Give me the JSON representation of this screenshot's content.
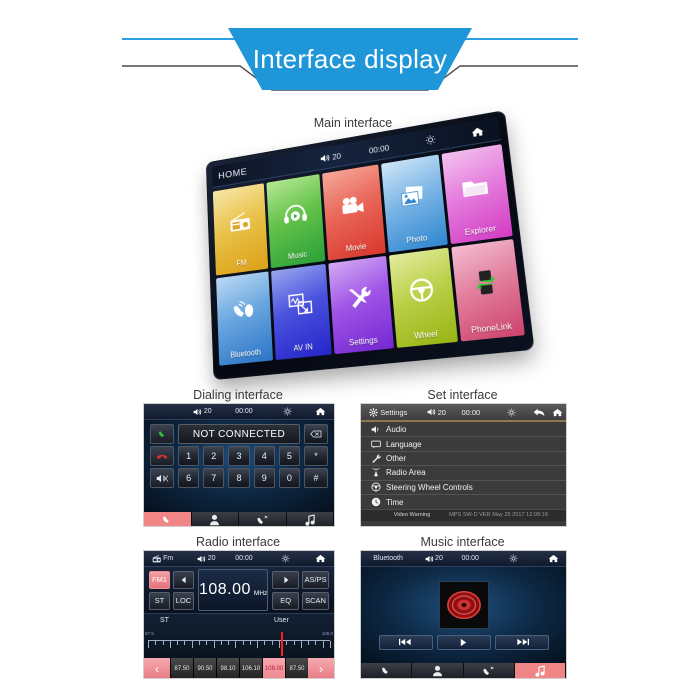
{
  "header": {
    "title": "Interface display",
    "accent_color": "#1e96d8"
  },
  "sections": {
    "main": {
      "caption": "Main interface"
    },
    "dialing": {
      "caption": "Dialing interface"
    },
    "settings": {
      "caption": "Set interface"
    },
    "radio": {
      "caption": "Radio interface"
    },
    "music": {
      "caption": "Music interface"
    }
  },
  "main_interface": {
    "statusbar": {
      "home_label": "HOME",
      "volume": "20",
      "clock": "00:00",
      "brightness_icon": "brightness-icon",
      "home_icon": "home-icon",
      "volume_icon": "volume-icon"
    },
    "tiles": [
      {
        "label": "FM",
        "icon": "radio-icon",
        "c1": "#f7e7a8",
        "c2": "#e0a822"
      },
      {
        "label": "Music",
        "icon": "headphone-icon",
        "c1": "#a9e08a",
        "c2": "#2fa23a"
      },
      {
        "label": "Movie",
        "icon": "camcorder-icon",
        "c1": "#f09a8d",
        "c2": "#e04a3c"
      },
      {
        "label": "Photo",
        "icon": "photo-icon",
        "c1": "#bcdcf5",
        "c2": "#3b8fd4"
      },
      {
        "label": "Explorer",
        "icon": "folder-icon",
        "c1": "#f0b6e8",
        "c2": "#d63fc4"
      },
      {
        "label": "Bluetooth",
        "icon": "phone-wave-icon",
        "c1": "#9ec8ef",
        "c2": "#2d74c8"
      },
      {
        "label": "AV IN",
        "icon": "av-in-icon",
        "c1": "#7f8fe8",
        "c2": "#2a2fd0"
      },
      {
        "label": "Settings",
        "icon": "tools-icon",
        "c1": "#c79bf0",
        "c2": "#7c2fd6"
      },
      {
        "label": "Wheel",
        "icon": "steering-icon",
        "c1": "#d3e07a",
        "c2": "#9cb81c"
      },
      {
        "label": "PhoneLink",
        "icon": "phonelink-icon",
        "c1": "#f0a7c2",
        "c2": "#d0486f"
      }
    ]
  },
  "dialing_interface": {
    "statusbar": {
      "volume": "20",
      "clock": "00:00"
    },
    "display_value": "NOT CONNECTED",
    "call_icon": "call-icon",
    "hangup_icon": "hangup-icon",
    "mute_icon": "mute-icon",
    "backspace_icon": "backspace-icon",
    "keys_row1": [
      "1",
      "2",
      "3",
      "4",
      "5",
      "*"
    ],
    "keys_row2": [
      "6",
      "7",
      "8",
      "9",
      "0",
      "#"
    ],
    "bottom_tabs": [
      {
        "icon": "dialpad-phone-icon",
        "active": true
      },
      {
        "icon": "contacts-icon",
        "active": false
      },
      {
        "icon": "call-log-icon",
        "active": false
      },
      {
        "icon": "music-note-icon",
        "active": false
      }
    ]
  },
  "settings_interface": {
    "statusbar": {
      "title": "Settings",
      "volume": "20",
      "clock": "00:00",
      "gear_icon": "gear-icon",
      "back_icon": "back-arrow-icon",
      "home_icon": "home-icon"
    },
    "items": [
      {
        "label": "Audio",
        "icon": "speaker-icon"
      },
      {
        "label": "Language",
        "icon": "screen-icon"
      },
      {
        "label": "Other",
        "icon": "wrench-icon"
      },
      {
        "label": "Radio Area",
        "icon": "antenna-icon"
      },
      {
        "label": "Steering Wheel Controls",
        "icon": "wheel-icon"
      },
      {
        "label": "Time",
        "icon": "clock-icon"
      }
    ],
    "footer": {
      "warning": "Video Warning",
      "version": "MPS SW-D VER May 25 2017 12:09:18"
    }
  },
  "radio_interface": {
    "statusbar": {
      "source": "Fm",
      "volume": "20",
      "clock": "00:00",
      "radio_icon": "radio-small-icon"
    },
    "band": "FM1",
    "prev_icon": "prev-arrow-icon",
    "next_icon": "next-arrow-icon",
    "buttons": {
      "st": "ST",
      "loc": "LOC",
      "as_ps": "AS/PS",
      "eq": "EQ",
      "scan": "SCAN"
    },
    "frequency": "108.00",
    "unit": "MHz",
    "scale": {
      "left_label": "ST",
      "right_label": "User",
      "min_text": "87.5",
      "max_text": "108.0"
    },
    "presets": [
      "87.50",
      "90.50",
      "98.10",
      "106.10",
      "108.00",
      "87.50"
    ],
    "active_preset_index": 4,
    "nav_prev": "‹",
    "nav_next": "›"
  },
  "music_interface": {
    "statusbar": {
      "source": "Bluetooth",
      "volume": "20",
      "clock": "00:00"
    },
    "album_icon": "vinyl-disc-icon",
    "controls": [
      {
        "icon": "previous-track-icon",
        "glyph": "◄◄"
      },
      {
        "icon": "play-icon",
        "glyph": "▶"
      },
      {
        "icon": "next-track-icon",
        "glyph": "►►"
      }
    ],
    "bottom_tabs": [
      {
        "icon": "dialpad-phone-icon",
        "active": false
      },
      {
        "icon": "contacts-icon",
        "active": false
      },
      {
        "icon": "call-log-icon",
        "active": false
      },
      {
        "icon": "music-note-icon",
        "active": true
      }
    ]
  }
}
